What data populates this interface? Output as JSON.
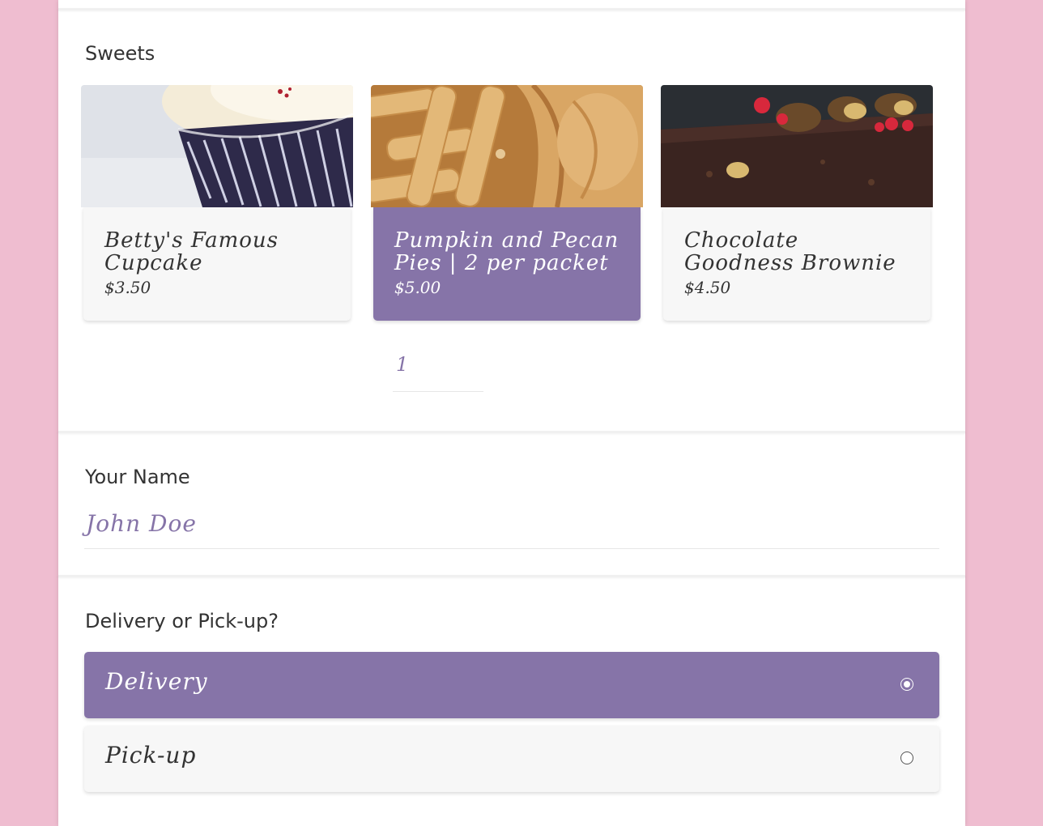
{
  "sweets_section": {
    "title": "Sweets",
    "products": [
      {
        "name": "Betty's Famous Cupcake",
        "price": "$3.50",
        "image": "cupcake-photo",
        "selected": false
      },
      {
        "name": "Pumpkin and Pecan Pies | 2 per packet",
        "price": "$5.00",
        "image": "pie-photo",
        "selected": true
      },
      {
        "name": "Chocolate Goodness Brownie",
        "price": "$4.50",
        "image": "brownie-photo",
        "selected": false
      }
    ],
    "quantity_value": "1"
  },
  "name_section": {
    "title": "Your Name",
    "value": "John Doe"
  },
  "delivery_section": {
    "title": "Delivery or Pick-up?",
    "options": [
      {
        "label": "Delivery",
        "selected": true
      },
      {
        "label": "Pick-up",
        "selected": false
      }
    ]
  },
  "colors": {
    "accent": "#8674a8",
    "background": "#efbdd0",
    "card": "#f7f7f7"
  }
}
